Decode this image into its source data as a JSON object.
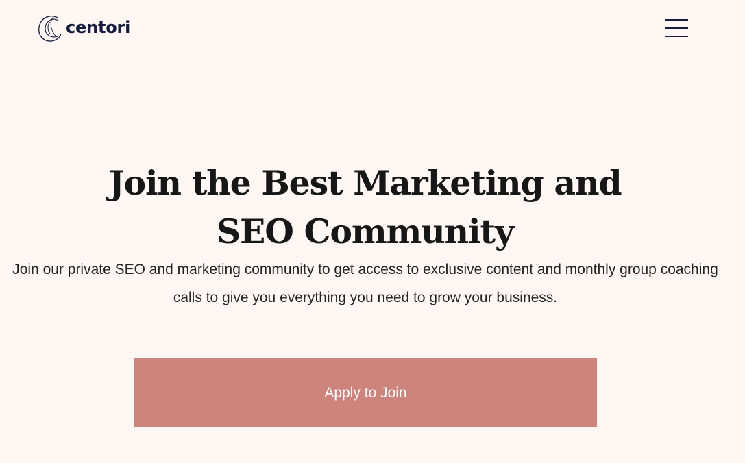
{
  "brand": {
    "name": "centori",
    "icon": "centori-logo-icon"
  },
  "header": {
    "menu_icon": "hamburger-menu-icon"
  },
  "hero": {
    "title": "Join the Best Marketing and SEO Community",
    "description": "Join our private SEO and marketing community to get access to exclusive content and monthly group coaching calls to give you everything you need to grow your business.",
    "cta_label": "Apply to Join"
  },
  "colors": {
    "background": "#fff7f3",
    "brand_navy": "#151c3f",
    "heading": "#171717",
    "button": "#cd847d",
    "button_text": "#ffffff"
  }
}
